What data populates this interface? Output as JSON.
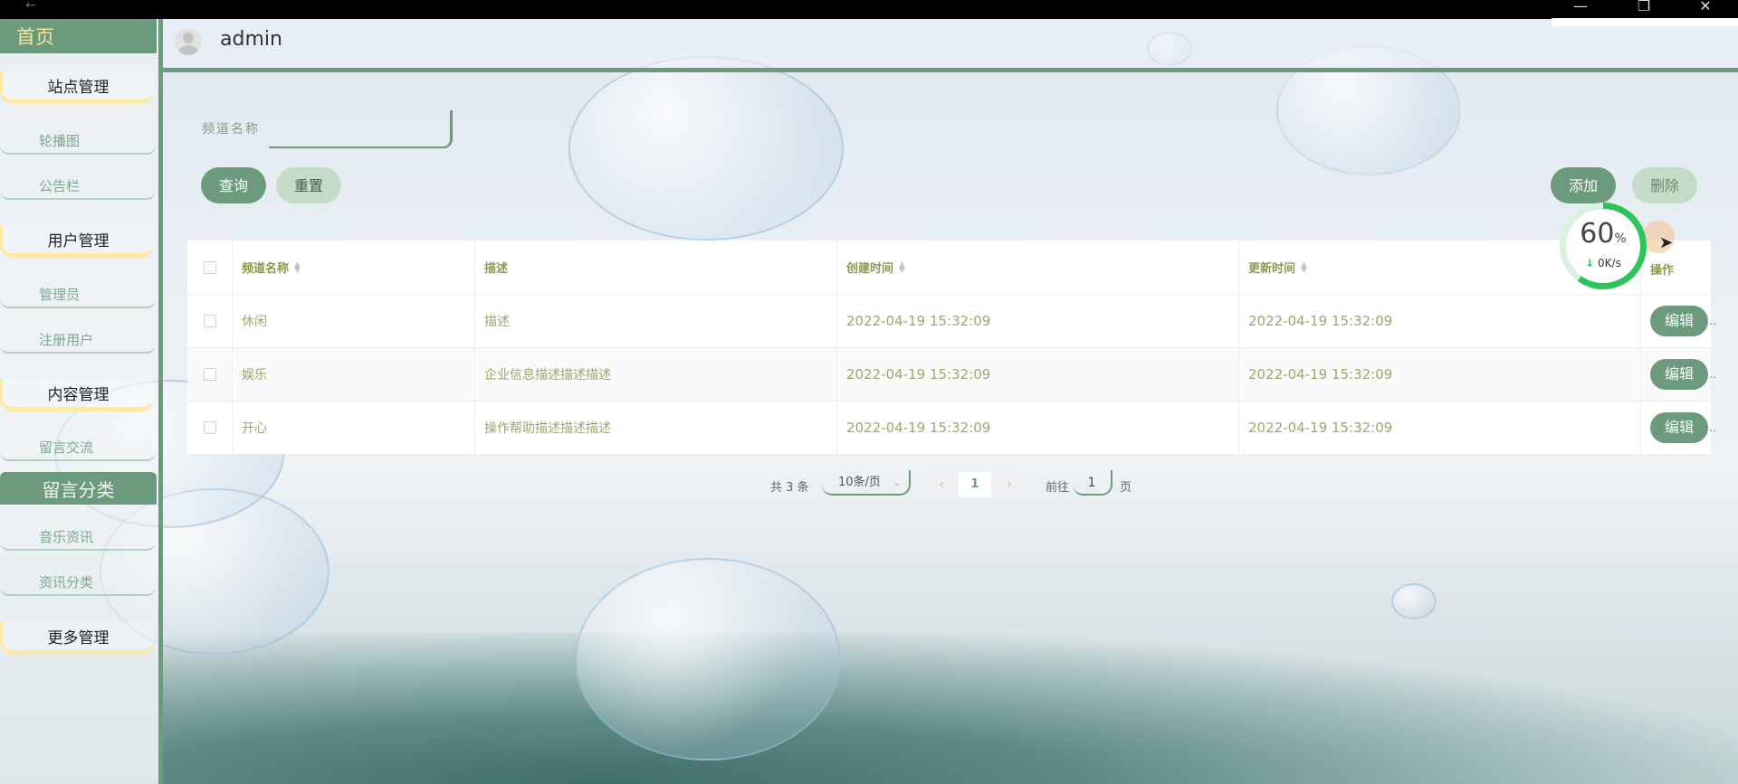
{
  "window": {
    "minimize_icon": "—",
    "maximize_icon": "❐",
    "close_icon": "✕"
  },
  "sidebar": {
    "home": "首页",
    "groups": [
      {
        "title": "站点管理",
        "items": [
          "轮播图",
          "公告栏"
        ]
      },
      {
        "title": "用户管理",
        "items": [
          "管理员",
          "注册用户"
        ]
      },
      {
        "title": "内容管理",
        "items": [
          "留言交流"
        ]
      }
    ],
    "active": "留言分类",
    "after_active": [
      "音乐资讯",
      "资讯分类"
    ],
    "more": "更多管理"
  },
  "header": {
    "username": "admin"
  },
  "search": {
    "label": "频道名称",
    "value": "",
    "query_label": "查询",
    "reset_label": "重置"
  },
  "toolbar": {
    "add_label": "添加",
    "delete_label": "删除"
  },
  "table": {
    "columns": [
      "频道名称",
      "描述",
      "创建时间",
      "更新时间",
      "操作"
    ],
    "rows": [
      {
        "name": "休闲",
        "desc": "描述",
        "created": "2022-04-19 15:32:09",
        "updated": "2022-04-19 15:32:09",
        "action": "编辑"
      },
      {
        "name": "娱乐",
        "desc": "企业信息描述描述描述",
        "created": "2022-04-19 15:32:09",
        "updated": "2022-04-19 15:32:09",
        "action": "编辑"
      },
      {
        "name": "开心",
        "desc": "操作帮助描述描述描述",
        "created": "2022-04-19 15:32:09",
        "updated": "2022-04-19 15:32:09",
        "action": "编辑"
      }
    ]
  },
  "pagination": {
    "total_text": "共 3 条",
    "page_size": "10条/页",
    "current_page": "1",
    "goto_label": "前往",
    "goto_value": "1",
    "page_suffix": "页"
  },
  "speed_widget": {
    "percent": "60",
    "percent_unit": "%",
    "rate": "0K/s",
    "fill": 0.6
  }
}
